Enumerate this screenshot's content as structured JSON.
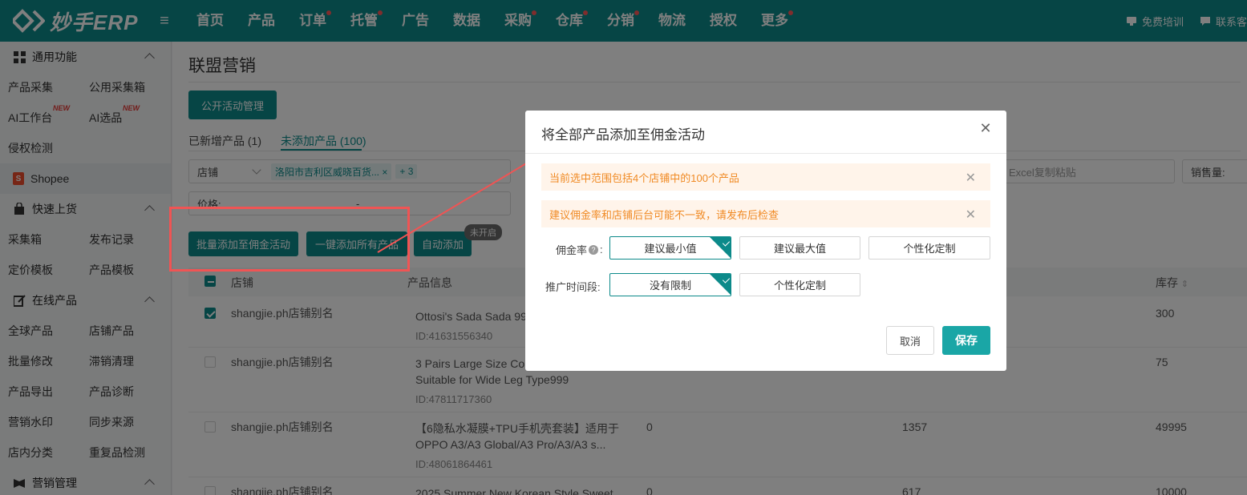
{
  "app": {
    "logo_text": "妙手ERP"
  },
  "topnav": [
    {
      "label": "首页",
      "dot": false
    },
    {
      "label": "产品",
      "dot": false
    },
    {
      "label": "订单",
      "dot": true
    },
    {
      "label": "托管",
      "dot": true
    },
    {
      "label": "广告",
      "dot": false
    },
    {
      "label": "数据",
      "dot": false
    },
    {
      "label": "采购",
      "dot": true
    },
    {
      "label": "仓库",
      "dot": true
    },
    {
      "label": "分销",
      "dot": true
    },
    {
      "label": "物流",
      "dot": false
    },
    {
      "label": "授权",
      "dot": false
    },
    {
      "label": "更多",
      "dot": true
    }
  ],
  "topright": {
    "training": "免费培训",
    "contact": "联系客"
  },
  "sidebar": {
    "common": {
      "title": "通用功能",
      "items": [
        "产品采集",
        "公用采集箱",
        "AI工作台",
        "AI选品",
        "侵权检测"
      ],
      "new_badge": "NEW"
    },
    "shopee": "Shopee",
    "quick": {
      "title": "快速上货",
      "items": [
        "采集箱",
        "发布记录",
        "定价模板",
        "产品模板"
      ]
    },
    "online": {
      "title": "在线产品",
      "items": [
        "全球产品",
        "店铺产品",
        "批量修改",
        "滞销清理",
        "产品导出",
        "产品诊断",
        "营销水印",
        "同步来源",
        "店内分类",
        "重复品检测"
      ]
    },
    "marketing": {
      "title": "营销管理"
    }
  },
  "page": {
    "title": "联盟营销",
    "public_mgmt_btn": "公开活动管理",
    "tabs": {
      "added": "已新增产品 (1)",
      "not_added": "未添加产品 (100)"
    },
    "filters": {
      "store_label": "店铺",
      "store_tag": "洛阳市吉利区威晓百货...",
      "store_more": "+ 3",
      "price_label": "价格:",
      "price_sep": "-",
      "excel_placeholder": "Excel复制粘贴",
      "sales_label": "销售量:"
    },
    "actions": {
      "batch_add": "批量添加至佣金活动",
      "add_all": "一键添加所有产品",
      "auto_add": "自动添加",
      "auto_status": "未开启"
    },
    "table": {
      "headers": {
        "store": "店铺",
        "product": "产品信息",
        "stock": "库存"
      },
      "rows": [
        {
          "store": "shangjie.ph店铺别名",
          "title_lines": [
            "Ottosi's Sada Sada 99"
          ],
          "id": "ID:41631556340",
          "c1": "",
          "c2": "",
          "stock": "300",
          "checked": true
        },
        {
          "store": "shangjie.ph店铺别名",
          "title_lines": [
            "3 Pairs Large Size Com",
            "Suitable for Wide Leg Type999"
          ],
          "id": "ID:47811717360",
          "c1": "",
          "c2": "",
          "stock": "75",
          "checked": false
        },
        {
          "store": "shangjie.ph店铺别名",
          "title_lines": [
            "【6隐私水凝膜+TPU手机壳套装】适用于",
            "OPPO A3/A3 Global/A3 Pro/A3/A3 s..."
          ],
          "id": "ID:48061864461",
          "c1": "0",
          "c2": "1357",
          "stock": "49995",
          "checked": false
        },
        {
          "store": "shangjie.ph店铺别名",
          "title_lines": [
            "2025 Summer New Korean Style Sweet"
          ],
          "id": "",
          "c1": "0",
          "c2": "617",
          "stock": "10000",
          "checked": false
        }
      ]
    }
  },
  "modal": {
    "title": "将全部产品添加至佣金活动",
    "alert1": "当前选中范围包括4个店铺中的100个产品",
    "alert2": "建议佣金率和店铺后台可能不一致，请发布后检查",
    "commission_label": "佣金率",
    "commission_suffix": ":",
    "commission_options": [
      "建议最小值",
      "建议最大值",
      "个性化定制"
    ],
    "period_label": "推广时间段:",
    "period_options": [
      "没有限制",
      "个性化定制"
    ],
    "cancel": "取消",
    "save": "保存"
  },
  "colors": {
    "brand": "#0c8a8a",
    "alert_bg": "#fff4ea",
    "alert_text": "#f08a24",
    "annotation": "#f05454"
  }
}
